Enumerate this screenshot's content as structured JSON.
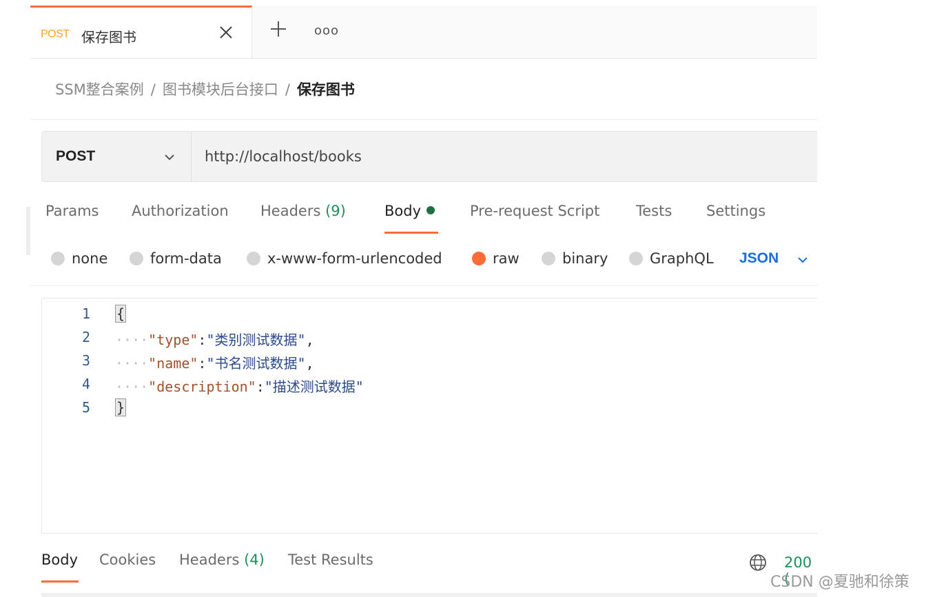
{
  "tab": {
    "method": "POST",
    "title": "保存图书",
    "close_icon": "close-icon",
    "add_icon": "plus-icon",
    "more_label": "ooo"
  },
  "breadcrumb": {
    "items": [
      "SSM整合案例",
      "图书模块后台接口"
    ],
    "separator": "/",
    "current": "保存图书"
  },
  "request": {
    "method": "POST",
    "url": "http://localhost/books"
  },
  "request_tabs": [
    {
      "label": "Params"
    },
    {
      "label": "Authorization"
    },
    {
      "label": "Headers",
      "count": "(9)"
    },
    {
      "label": "Body"
    },
    {
      "label": "Pre-request Script"
    },
    {
      "label": "Tests"
    },
    {
      "label": "Settings"
    }
  ],
  "body_types": {
    "options": [
      "none",
      "form-data",
      "x-www-form-urlencoded",
      "raw",
      "binary",
      "GraphQL"
    ],
    "selected": "raw",
    "language": "JSON"
  },
  "editor": {
    "line_numbers": [
      "1",
      "2",
      "3",
      "4",
      "5"
    ],
    "lines": [
      {
        "open": "{"
      },
      {
        "dots": "····",
        "key": "\"type\"",
        "colon": ":",
        "value": "\"类别测试数据\"",
        "comma": ","
      },
      {
        "dots": "····",
        "key": "\"name\"",
        "colon": ":",
        "value": "\"书名测试数据\"",
        "comma": ","
      },
      {
        "dots": "····",
        "key": "\"description\"",
        "colon": ":",
        "value": "\"描述测试数据\""
      },
      {
        "close": "}"
      }
    ]
  },
  "response_tabs": [
    {
      "label": "Body"
    },
    {
      "label": "Cookies"
    },
    {
      "label": "Headers",
      "count": "(4)"
    },
    {
      "label": "Test Results"
    }
  ],
  "status": "200 (",
  "watermark": "CSDN @夏驰和徐策",
  "colors": {
    "accent": "#ff6c37",
    "method_tab": "#f5a623",
    "success": "#1f8f5a",
    "link": "#1a6fd6"
  }
}
